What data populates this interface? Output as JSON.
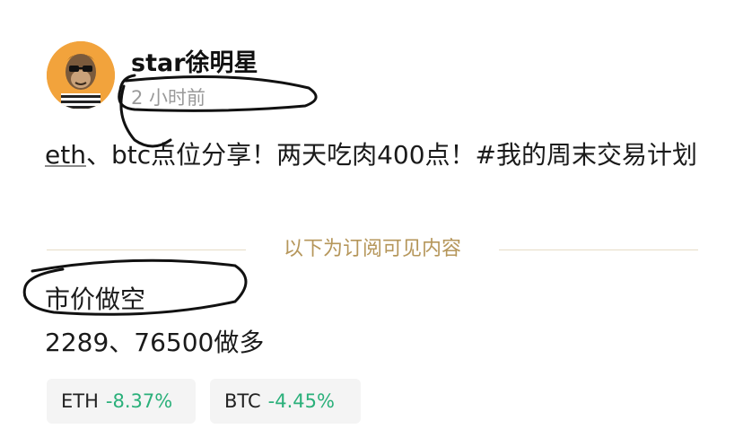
{
  "post": {
    "author": "star徐明星",
    "time": "2 小时前",
    "content_prefix": "eth",
    "content_rest": "、btc点位分享！两天吃肉400点！#我的周末交易计划",
    "divider_label": "以下为订阅可见内容",
    "line1": "市价做空",
    "line2": "2289、76500做多"
  },
  "tickers": [
    {
      "symbol": "ETH",
      "change": "-8.37%"
    },
    {
      "symbol": "BTC",
      "change": "-4.45%"
    }
  ],
  "colors": {
    "change_positive_display": "#2ab07a",
    "divider_label": "#b5965a",
    "avatar_bg": "#f2a33c"
  },
  "icons": {
    "avatar": "ape-avatar-icon"
  }
}
